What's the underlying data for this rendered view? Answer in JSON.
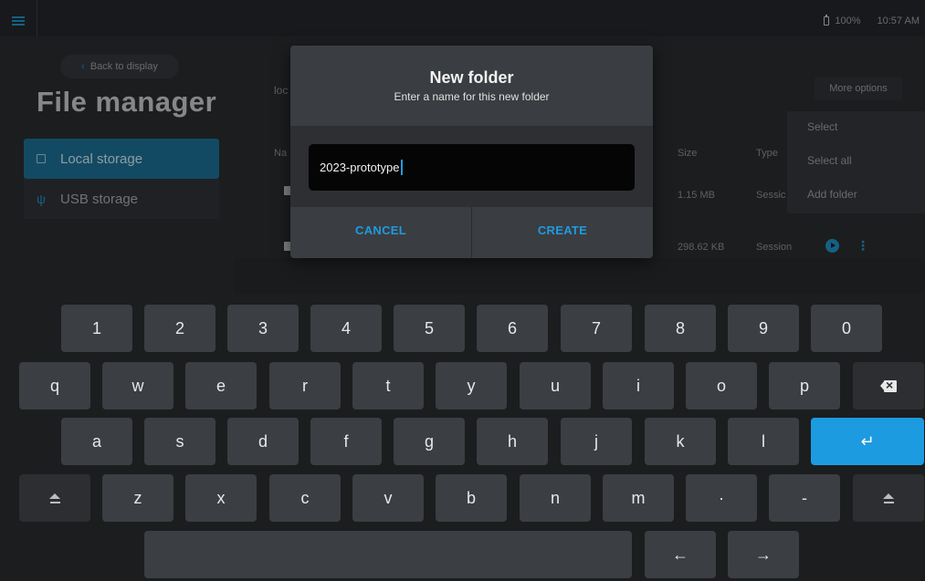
{
  "topbar": {
    "battery": "100%",
    "time": "10:57 AM"
  },
  "header": {
    "back_label": "Back to display",
    "title": "File manager"
  },
  "sidebar": {
    "items": [
      {
        "label": "Local storage",
        "icon": "storage-icon",
        "active": true
      },
      {
        "label": "USB storage",
        "icon": "usb-icon",
        "active": false
      }
    ]
  },
  "files": {
    "location_fragment": "loc",
    "name_header_fragment": "Na",
    "columns": {
      "size": "Size",
      "type": "Type"
    },
    "rows": [
      {
        "size": "1.15 MB",
        "type": "Sessic"
      },
      {
        "size": "298.62 KB",
        "type": "Session"
      }
    ]
  },
  "options": {
    "more_label": "More options",
    "menu": [
      "Select",
      "Select all",
      "Add folder"
    ]
  },
  "dialog": {
    "title": "New folder",
    "subtitle": "Enter a name for this new folder",
    "input_value": "2023-prototype",
    "cancel_label": "CANCEL",
    "create_label": "CREATE"
  },
  "keyboard": {
    "row1": [
      "1",
      "2",
      "3",
      "4",
      "5",
      "6",
      "7",
      "8",
      "9",
      "0"
    ],
    "row2": [
      "q",
      "w",
      "e",
      "r",
      "t",
      "y",
      "u",
      "i",
      "o",
      "p"
    ],
    "row3": [
      "a",
      "s",
      "d",
      "f",
      "g",
      "h",
      "j",
      "k",
      "l"
    ],
    "row4": [
      "z",
      "x",
      "c",
      "v",
      "b",
      "n",
      "m",
      "·",
      "-"
    ],
    "left_arrow": "←",
    "right_arrow": "→",
    "enter_glyph": "↵",
    "accent_color": "#1d9be0"
  }
}
